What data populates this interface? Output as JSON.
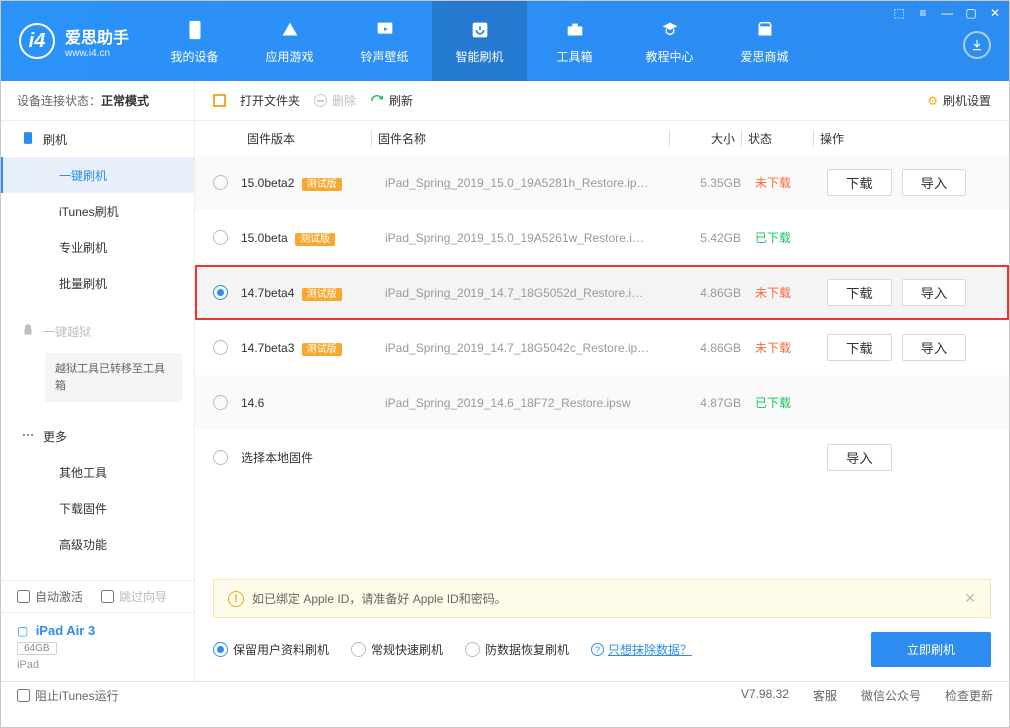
{
  "brand": {
    "name": "爱思助手",
    "url": "www.i4.cn"
  },
  "nav": [
    {
      "key": "device",
      "label": "我的设备"
    },
    {
      "key": "apps",
      "label": "应用游戏"
    },
    {
      "key": "ringtone",
      "label": "铃声壁纸"
    },
    {
      "key": "flash",
      "label": "智能刷机"
    },
    {
      "key": "tools",
      "label": "工具箱"
    },
    {
      "key": "tutorial",
      "label": "教程中心"
    },
    {
      "key": "shop",
      "label": "爱思商城"
    }
  ],
  "connStatus": {
    "label": "设备连接状态：",
    "value": "正常模式"
  },
  "sidebar": {
    "groups": [
      {
        "head": "刷机",
        "items": [
          "一键刷机",
          "iTunes刷机",
          "专业刷机",
          "批量刷机"
        ]
      },
      {
        "head": "一键越狱",
        "disabled": true,
        "note": "越狱工具已转移至工具箱"
      },
      {
        "head": "更多",
        "items": [
          "其他工具",
          "下载固件",
          "高级功能"
        ]
      }
    ],
    "activeSub": "一键刷机",
    "checks": {
      "autoActivate": "自动激活",
      "skipGuide": "跳过向导"
    },
    "device": {
      "name": "iPad Air 3",
      "storage": "64GB",
      "model": "iPad"
    }
  },
  "toolbar": {
    "open": "打开文件夹",
    "delete": "删除",
    "refresh": "刷新",
    "settings": "刷机设置"
  },
  "columns": {
    "version": "固件版本",
    "name": "固件名称",
    "size": "大小",
    "status": "状态",
    "ops": "操作"
  },
  "rows": [
    {
      "ver": "15.0beta2",
      "beta": true,
      "name": "iPad_Spring_2019_15.0_19A5281h_Restore.ip…",
      "size": "5.35GB",
      "status": "未下载",
      "statusClass": "wait",
      "ops": [
        "下载",
        "导入"
      ],
      "sel": false
    },
    {
      "ver": "15.0beta",
      "beta": true,
      "name": "iPad_Spring_2019_15.0_19A5261w_Restore.i…",
      "size": "5.42GB",
      "status": "已下载",
      "statusClass": "done",
      "ops": [],
      "sel": false
    },
    {
      "ver": "14.7beta4",
      "beta": true,
      "name": "iPad_Spring_2019_14.7_18G5052d_Restore.i…",
      "size": "4.86GB",
      "status": "未下载",
      "statusClass": "wait",
      "ops": [
        "下载",
        "导入"
      ],
      "sel": true,
      "hilite": true
    },
    {
      "ver": "14.7beta3",
      "beta": true,
      "name": "iPad_Spring_2019_14.7_18G5042c_Restore.ip…",
      "size": "4.86GB",
      "status": "未下载",
      "statusClass": "wait",
      "ops": [
        "下载",
        "导入"
      ],
      "sel": false
    },
    {
      "ver": "14.6",
      "beta": false,
      "name": "iPad_Spring_2019_14.6_18F72_Restore.ipsw",
      "size": "4.87GB",
      "status": "已下载",
      "statusClass": "done",
      "ops": [],
      "sel": false
    },
    {
      "ver": "",
      "localLabel": "选择本地固件",
      "ops": [
        "导入"
      ]
    }
  ],
  "betaLabel": "测试版",
  "warn": "如已绑定 Apple ID，请准备好 Apple ID和密码。",
  "flashOpts": {
    "items": [
      "保留用户资料刷机",
      "常规快速刷机",
      "防数据恢复刷机"
    ],
    "selected": 0,
    "eraseLink": "只想抹除数据？",
    "flashNow": "立即刷机"
  },
  "statusbar": {
    "blockItunes": "阻止iTunes运行",
    "version": "V7.98.32",
    "support": "客服",
    "wechat": "微信公众号",
    "update": "检查更新"
  }
}
